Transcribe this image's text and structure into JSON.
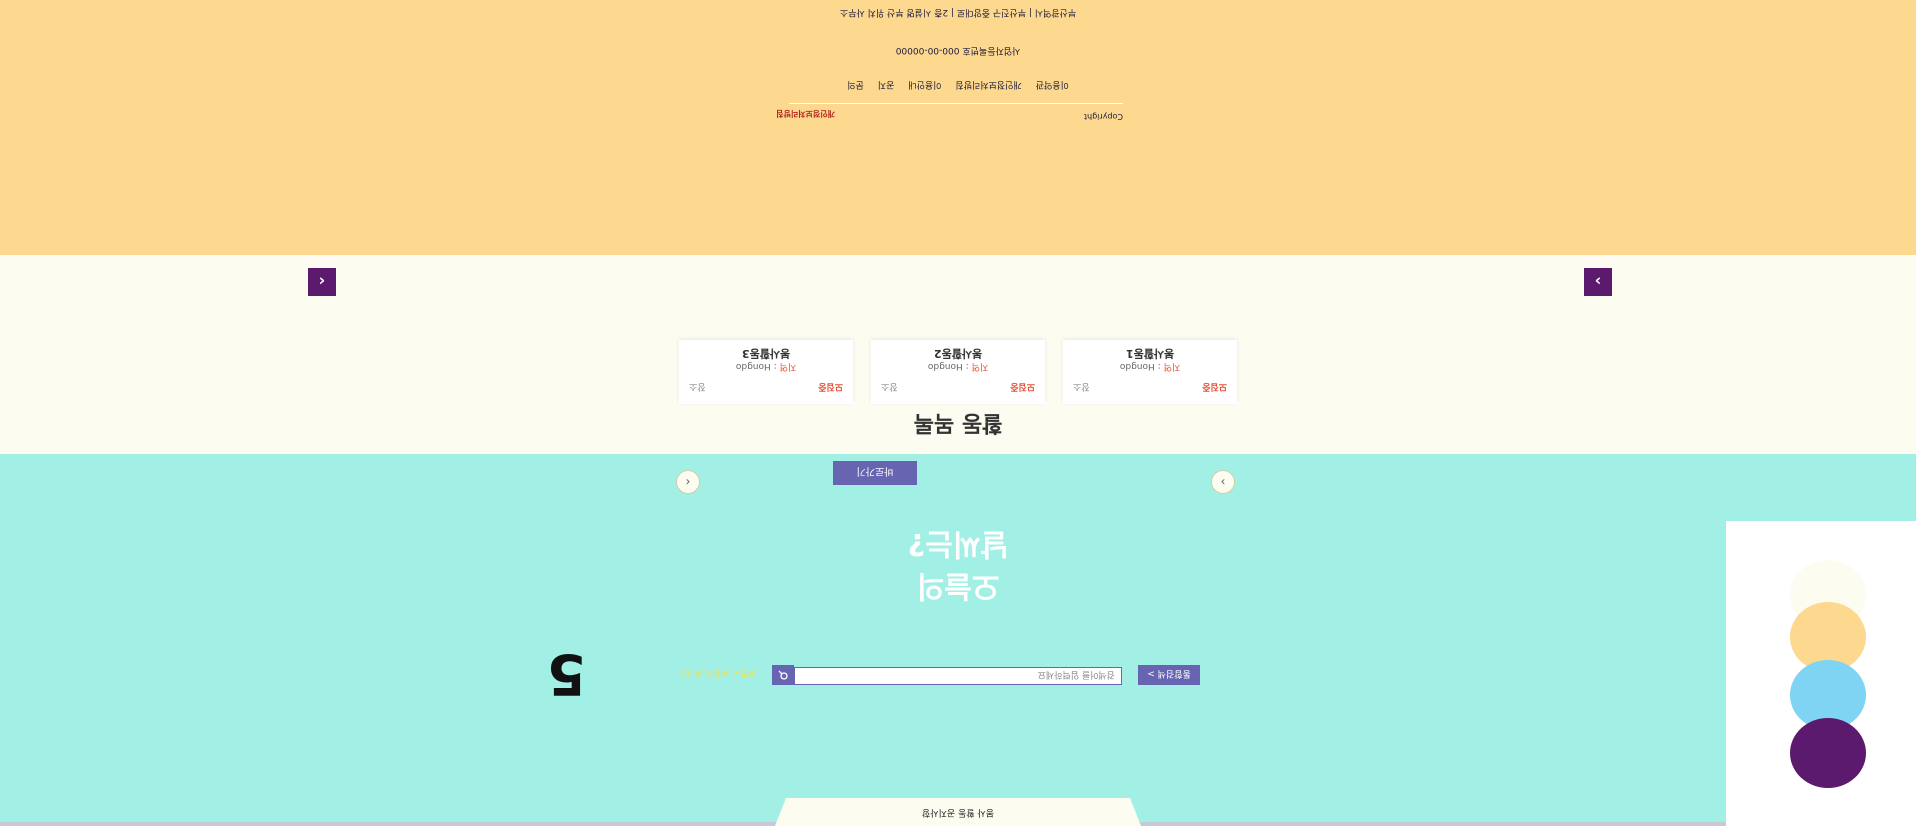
{
  "footer": {
    "address": "부산광역시 | 부산진구 중앙대로 | 2층 시설명 부산 위치 사무소",
    "business": "사업자등록번호 000-00-00000",
    "links": [
      "이용약관",
      "개인정보처리방침",
      "이용안내",
      "공지",
      "문의"
    ],
    "badge": "개인정보처리방침",
    "copyright": "Copyright"
  },
  "activity": {
    "title": "활동 목록",
    "cards": [
      {
        "status": "모집중",
        "region": "지역",
        "region_value": "Hongdo",
        "place": "장소",
        "name": "봉사활동1"
      },
      {
        "status": "모집중",
        "region": "지역",
        "region_value": "Hongdo",
        "place": "장소",
        "name": "봉사활동2"
      },
      {
        "status": "모집중",
        "region": "지역",
        "region_value": "Hongdo",
        "place": "장소",
        "name": "봉사활동3"
      }
    ],
    "prev": "‹",
    "next": "›"
  },
  "hero": {
    "button": "바로가기",
    "title_line1": "오늘의",
    "title_line2": "날씨는?",
    "search_placeholder": "검색어를 입력하세요",
    "search_button": "통합검색 >",
    "tags": "#봉사 #활동 #나눔",
    "big_number": "5",
    "tab_text": "봉사 활동 공지사항"
  },
  "palette": {
    "colors": [
      "#5b1a6e",
      "#7fd4f4",
      "#fdd88f",
      "#fdfcf1"
    ]
  }
}
